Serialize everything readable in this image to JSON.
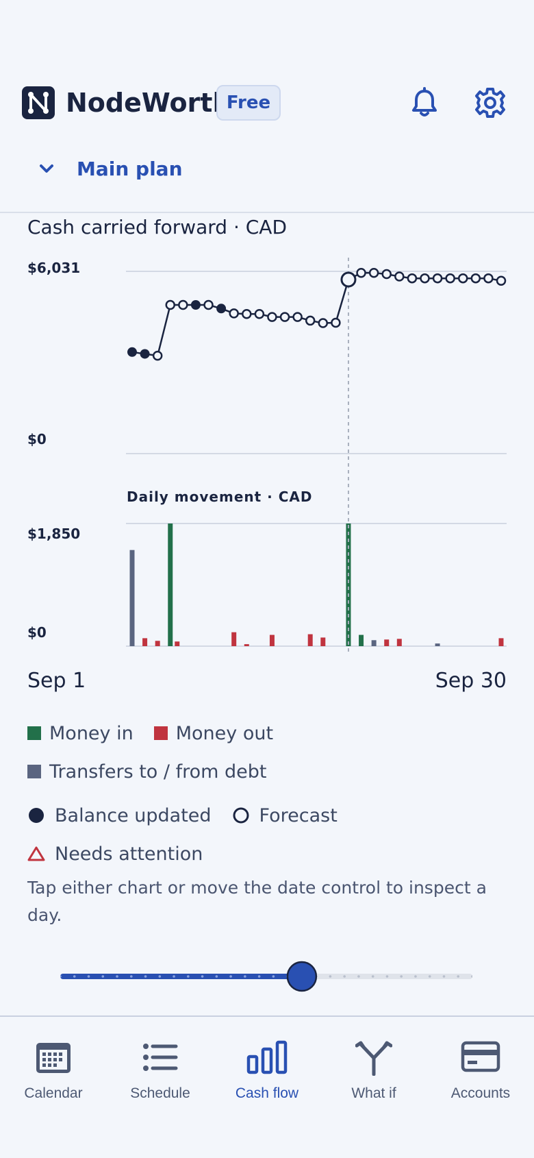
{
  "app": {
    "name": "NodeWorth",
    "plan_badge": "Free"
  },
  "plan_selector": {
    "label": "Main plan"
  },
  "chart": {
    "title": "Cash carried forward · CAD",
    "top_label": "$6,031",
    "zero_label": "$0",
    "movement_title": "Daily movement · CAD",
    "movement_top_label": "$1,850",
    "movement_zero_label": "$0",
    "start_date": "Sep 1",
    "end_date": "Sep 30"
  },
  "legend": {
    "money_in": "Money in",
    "money_out": "Money out",
    "transfers": "Transfers to / from debt",
    "balance_updated": "Balance updated",
    "forecast": "Forecast",
    "needs_attention": "Needs attention"
  },
  "help_text": "Tap either chart or move the date control to inspect a day.",
  "slider": {
    "selected_day": 18,
    "total_days": 30
  },
  "tabs": [
    {
      "label": "Calendar",
      "icon": "calendar-icon"
    },
    {
      "label": "Schedule",
      "icon": "list-icon"
    },
    {
      "label": "Cash flow",
      "icon": "bar-chart-icon",
      "active": true
    },
    {
      "label": "What if",
      "icon": "branch-icon"
    },
    {
      "label": "Accounts",
      "icon": "card-icon"
    }
  ],
  "colors": {
    "accent": "#2950b2",
    "money_in": "#22704a",
    "money_out": "#c0343f",
    "transfers": "#5a6580",
    "ink": "#1a2440"
  },
  "chart_data": [
    {
      "type": "line",
      "title": "Cash carried forward · CAD",
      "x": [
        "Sep 1",
        "Sep 2",
        "Sep 3",
        "Sep 4",
        "Sep 5",
        "Sep 6",
        "Sep 7",
        "Sep 8",
        "Sep 9",
        "Sep 10",
        "Sep 11",
        "Sep 12",
        "Sep 13",
        "Sep 14",
        "Sep 15",
        "Sep 16",
        "Sep 17",
        "Sep 18",
        "Sep 19",
        "Sep 20",
        "Sep 21",
        "Sep 22",
        "Sep 23",
        "Sep 24",
        "Sep 25",
        "Sep 26",
        "Sep 27",
        "Sep 28",
        "Sep 29",
        "Sep 30"
      ],
      "values": [
        3360,
        3300,
        3240,
        4920,
        4920,
        4920,
        4920,
        4800,
        4640,
        4620,
        4620,
        4520,
        4520,
        4520,
        4400,
        4320,
        4330,
        5760,
        5980,
        5980,
        5940,
        5860,
        5800,
        5800,
        5800,
        5800,
        5800,
        5800,
        5800,
        5720
      ],
      "point_kind": [
        "actual",
        "actual",
        "forecast",
        "forecast",
        "forecast",
        "actual",
        "forecast",
        "actual",
        "forecast",
        "forecast",
        "forecast",
        "forecast",
        "forecast",
        "forecast",
        "forecast",
        "forecast",
        "forecast",
        "forecast",
        "forecast",
        "forecast",
        "forecast",
        "forecast",
        "forecast",
        "forecast",
        "forecast",
        "forecast",
        "forecast",
        "forecast",
        "forecast",
        "forecast"
      ],
      "ylim": [
        0,
        6031
      ],
      "selected_index": 17
    },
    {
      "type": "bar",
      "title": "Daily movement · CAD",
      "x": [
        "Sep 1",
        "Sep 2",
        "Sep 3",
        "Sep 4",
        "Sep 5",
        "Sep 6",
        "Sep 7",
        "Sep 8",
        "Sep 9",
        "Sep 10",
        "Sep 11",
        "Sep 12",
        "Sep 13",
        "Sep 14",
        "Sep 15",
        "Sep 16",
        "Sep 17",
        "Sep 18",
        "Sep 19",
        "Sep 20",
        "Sep 21",
        "Sep 22",
        "Sep 23",
        "Sep 24",
        "Sep 25",
        "Sep 26",
        "Sep 27",
        "Sep 28",
        "Sep 29",
        "Sep 30"
      ],
      "series": [
        {
          "name": "Money in",
          "values": [
            0,
            0,
            0,
            1850,
            0,
            0,
            0,
            0,
            0,
            0,
            0,
            0,
            0,
            0,
            0,
            0,
            0,
            1850,
            170,
            0,
            0,
            0,
            0,
            0,
            0,
            0,
            0,
            0,
            0,
            0
          ]
        },
        {
          "name": "Money out",
          "values": [
            0,
            120,
            80,
            70,
            0,
            0,
            0,
            0,
            210,
            30,
            0,
            170,
            0,
            0,
            180,
            130,
            0,
            0,
            0,
            0,
            100,
            110,
            0,
            0,
            0,
            0,
            0,
            0,
            0,
            120
          ]
        },
        {
          "name": "Transfers to / from debt",
          "values": [
            1450,
            0,
            0,
            0,
            0,
            0,
            0,
            0,
            0,
            0,
            0,
            0,
            0,
            0,
            0,
            0,
            0,
            0,
            0,
            90,
            0,
            0,
            0,
            0,
            40,
            0,
            0,
            0,
            0,
            0
          ]
        }
      ],
      "ylim": [
        0,
        1850
      ]
    }
  ]
}
